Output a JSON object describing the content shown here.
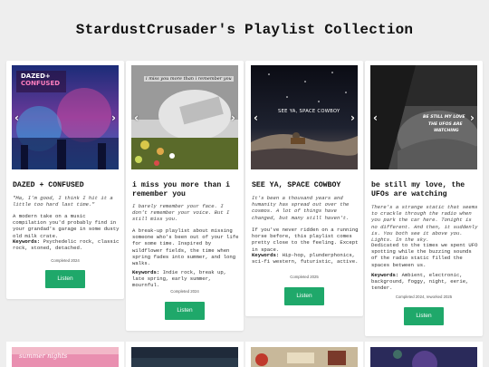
{
  "page": {
    "title": "StardustCrusader's Playlist Collection"
  },
  "carousel": {
    "prev": "‹",
    "next": "›"
  },
  "cards": [
    {
      "title": "DAZED + CONFUSED",
      "cover_text": [
        "DAZED+",
        "CONFUSED"
      ],
      "quote": "\"Ma, I'm good, I think I hit it a little too hard last time.\"",
      "description": "A modern take on a music compilation you'd probably find in your grandad's garage in some dusty old milk crate.",
      "keywords_label": "Keywords:",
      "keywords": "Psychedelic rock, classic rock, stoned, detached.",
      "completed": "Completed 2024",
      "listen": "Listen"
    },
    {
      "title": "i miss you more than i remember you",
      "cover_text": [
        "i miss you more than i remember you"
      ],
      "quote": "I barely remember your face. I don't remember your voice. But I still miss you.",
      "description": "A break-up playlist about missing someone who's been out of your life for some time. Inspired by wildflower fields, the time when spring fades into summer, and long walks.",
      "keywords_label": "Keywords:",
      "keywords": "Indie rock, break up, late spring, early summer, mournful.",
      "completed": "Completed 2024",
      "listen": "Listen"
    },
    {
      "title": "SEE YA, SPACE COWBOY",
      "cover_text": [
        "SEE YA, SPACE COWBOY"
      ],
      "quote": "It's been a thousand years and humanity has spread out over the cosmos. A lot of things have changed, but many still haven't.",
      "description": "If you've never ridden on a running horse before, this playlist comes pretty close to the feeling. Except in space.",
      "keywords_label": "Keywords:",
      "keywords": "Hip-hop, plunderphonics, sci-fi western, futuristic, active.",
      "completed": "Completed 2025",
      "listen": "Listen"
    },
    {
      "title": "be still my love, the UFOs are watching",
      "cover_text": [
        "BE STILL MY LOVE",
        "THE UFOS ARE",
        "WATCHING"
      ],
      "quote": "There's a strange static that seems to crackle through the radio when you park the car here. Tonight is no different. And then, it suddenly is. You both see it above you. Lights. In the sky.",
      "description": "Dedicated to the times we spent UFO spotting while the buzzing sounds of the radio static filled the spaces between us.",
      "keywords_label": "Keywords:",
      "keywords": "Ambient, electronic, background, foggy, night, eerie, tender.",
      "completed": "Completed 2024, reworked 2025",
      "listen": "Listen"
    }
  ],
  "bottom_row": {
    "first_cover_text": "summer nights"
  },
  "colors": {
    "listen_button": "#1fa86a",
    "background": "#eeeeee"
  }
}
